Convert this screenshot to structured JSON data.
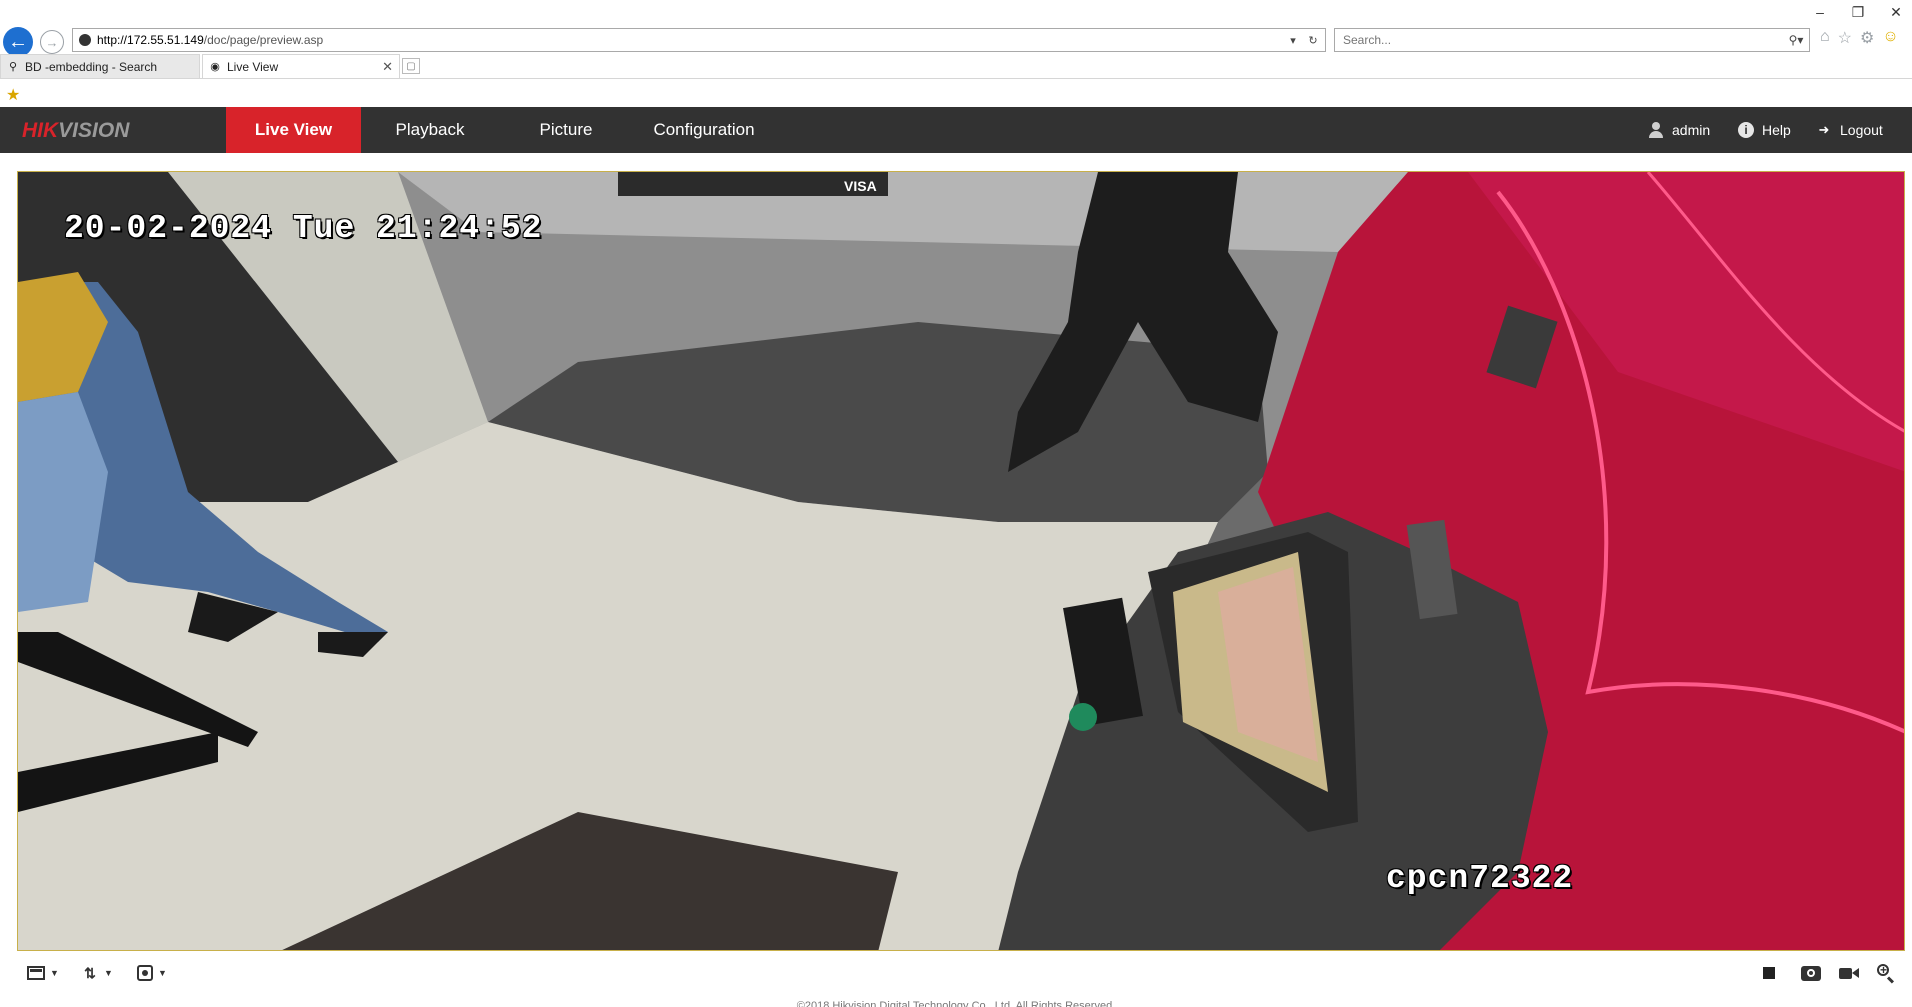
{
  "browser": {
    "window_controls": [
      "–",
      "❐",
      "✕"
    ],
    "url_host": "http://172.55.51.149",
    "url_path": "/doc/page/preview.asp",
    "search_placeholder": "Search...",
    "tabs": [
      {
        "label": "BD -embedding - Search",
        "active": false
      },
      {
        "label": "Live View",
        "active": true
      }
    ]
  },
  "app": {
    "brand_hik": "HIK",
    "brand_vision": "VISION",
    "brand_color": "#d8232a",
    "nav": {
      "live_view": "Live View",
      "playback": "Playback",
      "picture": "Picture",
      "configuration": "Configuration"
    },
    "user": {
      "username": "admin",
      "help": "Help",
      "logout": "Logout"
    }
  },
  "video": {
    "osd_datetime": "20-02-2024 Tue 21:24:52",
    "osd_channel_name": "cpcn72322"
  },
  "controls": {
    "icons": [
      "window-layout-icon",
      "stream-type-icon",
      "plugin-icon",
      "stop-all-icon",
      "capture-icon",
      "record-icon",
      "digital-zoom-icon"
    ]
  },
  "footer": {
    "copyright": "©2018 Hikvision Digital Technology Co., Ltd. All Rights Reserved."
  }
}
